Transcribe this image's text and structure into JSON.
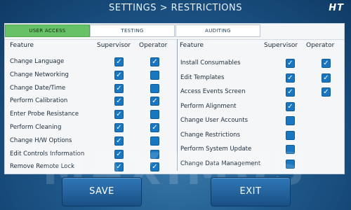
{
  "header": {
    "title": "SETTINGS > RESTRICTIONS",
    "brand": "HT"
  },
  "tabs": [
    {
      "label": "USER ACCESS",
      "active": true
    },
    {
      "label": "TESTING",
      "active": false
    },
    {
      "label": "AUDITING",
      "active": false
    }
  ],
  "columns": {
    "feature": "Feature",
    "supervisor": "Supervisor",
    "operator": "Operator"
  },
  "left_rows": [
    {
      "label": "Change Language",
      "supervisor": true,
      "operator": true
    },
    {
      "label": "Change Networking",
      "supervisor": true,
      "operator": false
    },
    {
      "label": "Change Date/Time",
      "supervisor": true,
      "operator": false
    },
    {
      "label": "Perform Calibration",
      "supervisor": true,
      "operator": true
    },
    {
      "label": "Enter Probe Resistance",
      "supervisor": true,
      "operator": false
    },
    {
      "label": "Perform Cleaning",
      "supervisor": true,
      "operator": true
    },
    {
      "label": "Change H/W Options",
      "supervisor": true,
      "operator": false
    },
    {
      "label": "Edit Controls Information",
      "supervisor": true,
      "operator": false
    },
    {
      "label": "Remove Remote Lock",
      "supervisor": true,
      "operator": true
    }
  ],
  "right_rows": [
    {
      "label": "Install Consumables",
      "supervisor": true,
      "operator": true
    },
    {
      "label": "Edit Templates",
      "supervisor": true,
      "operator": true
    },
    {
      "label": "Access Events Screen",
      "supervisor": true,
      "operator": true
    },
    {
      "label": "Perform Alignment",
      "supervisor": true,
      "operator": null
    },
    {
      "label": "Change User Accounts",
      "supervisor": false,
      "operator": null
    },
    {
      "label": "Change Restrictions",
      "supervisor": false,
      "operator": null
    },
    {
      "label": "Perform System Update",
      "supervisor": false,
      "operator": null
    },
    {
      "label": "Change Data Management",
      "supervisor": false,
      "operator": null
    }
  ],
  "watermark": "MAXIMUS",
  "buttons": {
    "save": "SAVE",
    "exit": "EXIT"
  },
  "colors": {
    "accent_tab": "#67c267",
    "checkbox": "#1976c0",
    "button": "#2f78b7"
  }
}
